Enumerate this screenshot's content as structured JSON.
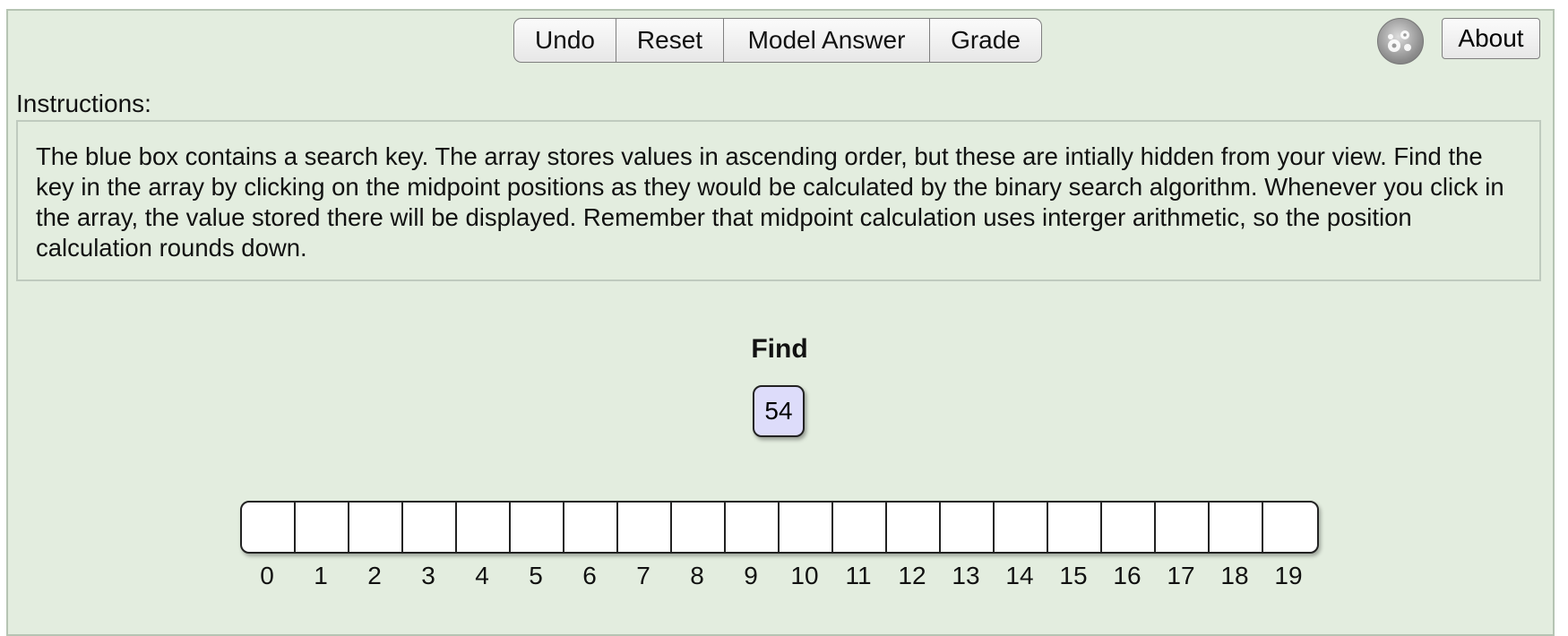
{
  "toolbar": {
    "undo_label": "Undo",
    "reset_label": "Reset",
    "model_answer_label": "Model Answer",
    "grade_label": "Grade"
  },
  "about_label": "About",
  "instructions": {
    "label": "Instructions:",
    "text": "The blue box contains a search key. The array stores values in ascending order, but these are intially hidden from your view. Find the key in the array by clicking on the midpoint positions as they would be calculated by the binary search algorithm. Whenever you click in the array, the value stored there will be displayed. Remember that midpoint calculation uses interger arithmetic, so the position calculation rounds down."
  },
  "find": {
    "label": "Find",
    "key": "54"
  },
  "array": {
    "indices": [
      "0",
      "1",
      "2",
      "3",
      "4",
      "5",
      "6",
      "7",
      "8",
      "9",
      "10",
      "11",
      "12",
      "13",
      "14",
      "15",
      "16",
      "17",
      "18",
      "19"
    ]
  },
  "colors": {
    "background": "#e3eddf",
    "key_box": "#dddcfa"
  },
  "icons": {
    "settings": "gear-icon"
  }
}
